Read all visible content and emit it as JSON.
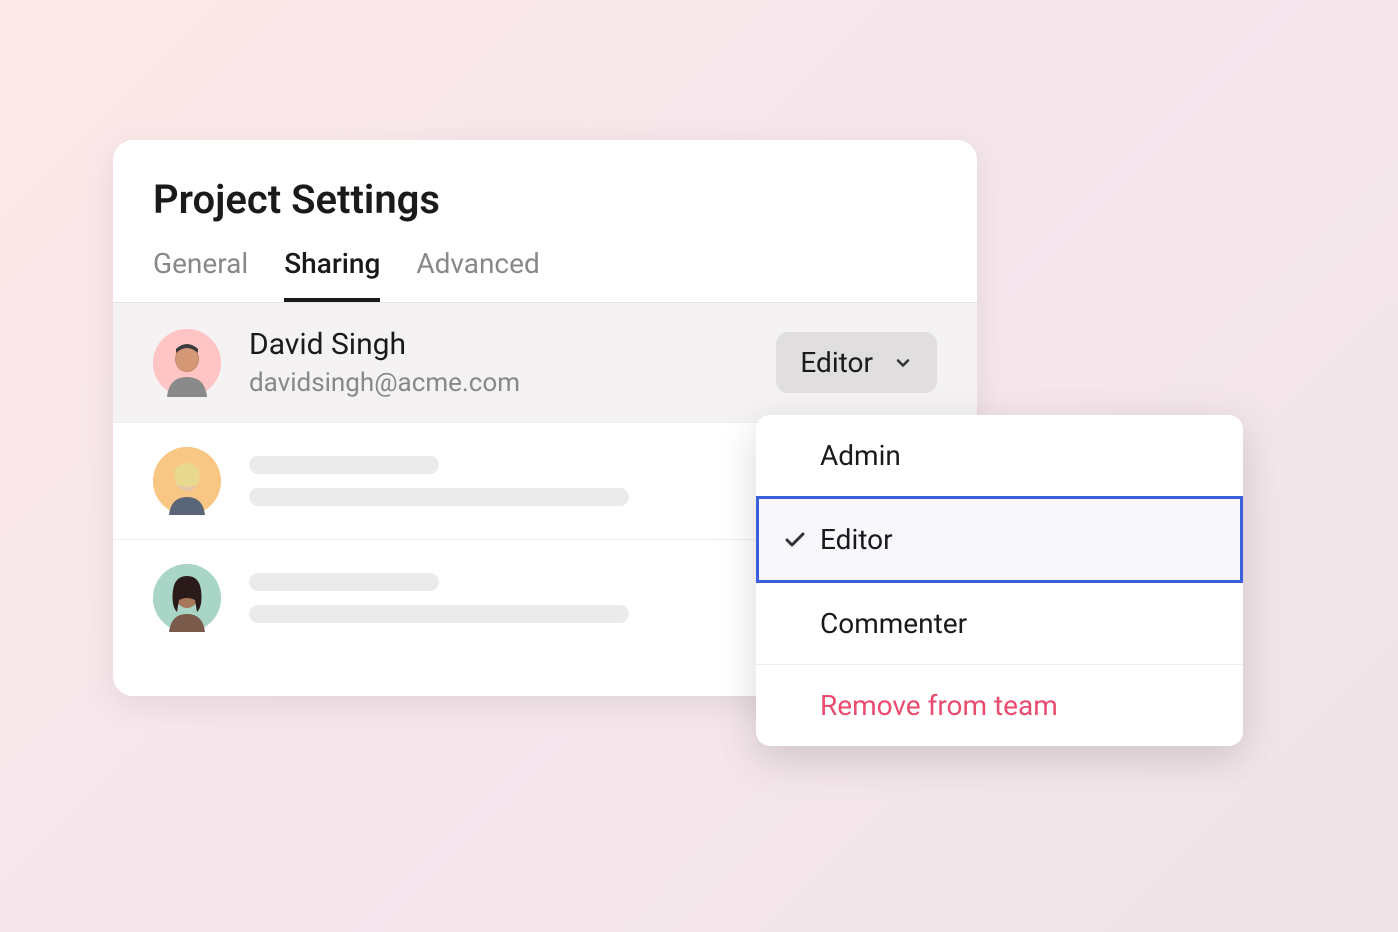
{
  "settings": {
    "title": "Project Settings",
    "tabs": [
      {
        "label": "General",
        "active": false
      },
      {
        "label": "Sharing",
        "active": true
      },
      {
        "label": "Advanced",
        "active": false
      }
    ]
  },
  "members": [
    {
      "name": "David Singh",
      "email": "davidsingh@acme.com",
      "role_selected": "Editor"
    }
  ],
  "role_dropdown": {
    "options": [
      {
        "label": "Admin",
        "selected": false
      },
      {
        "label": "Editor",
        "selected": true
      },
      {
        "label": "Commenter",
        "selected": false
      }
    ],
    "remove_label": "Remove from team"
  }
}
